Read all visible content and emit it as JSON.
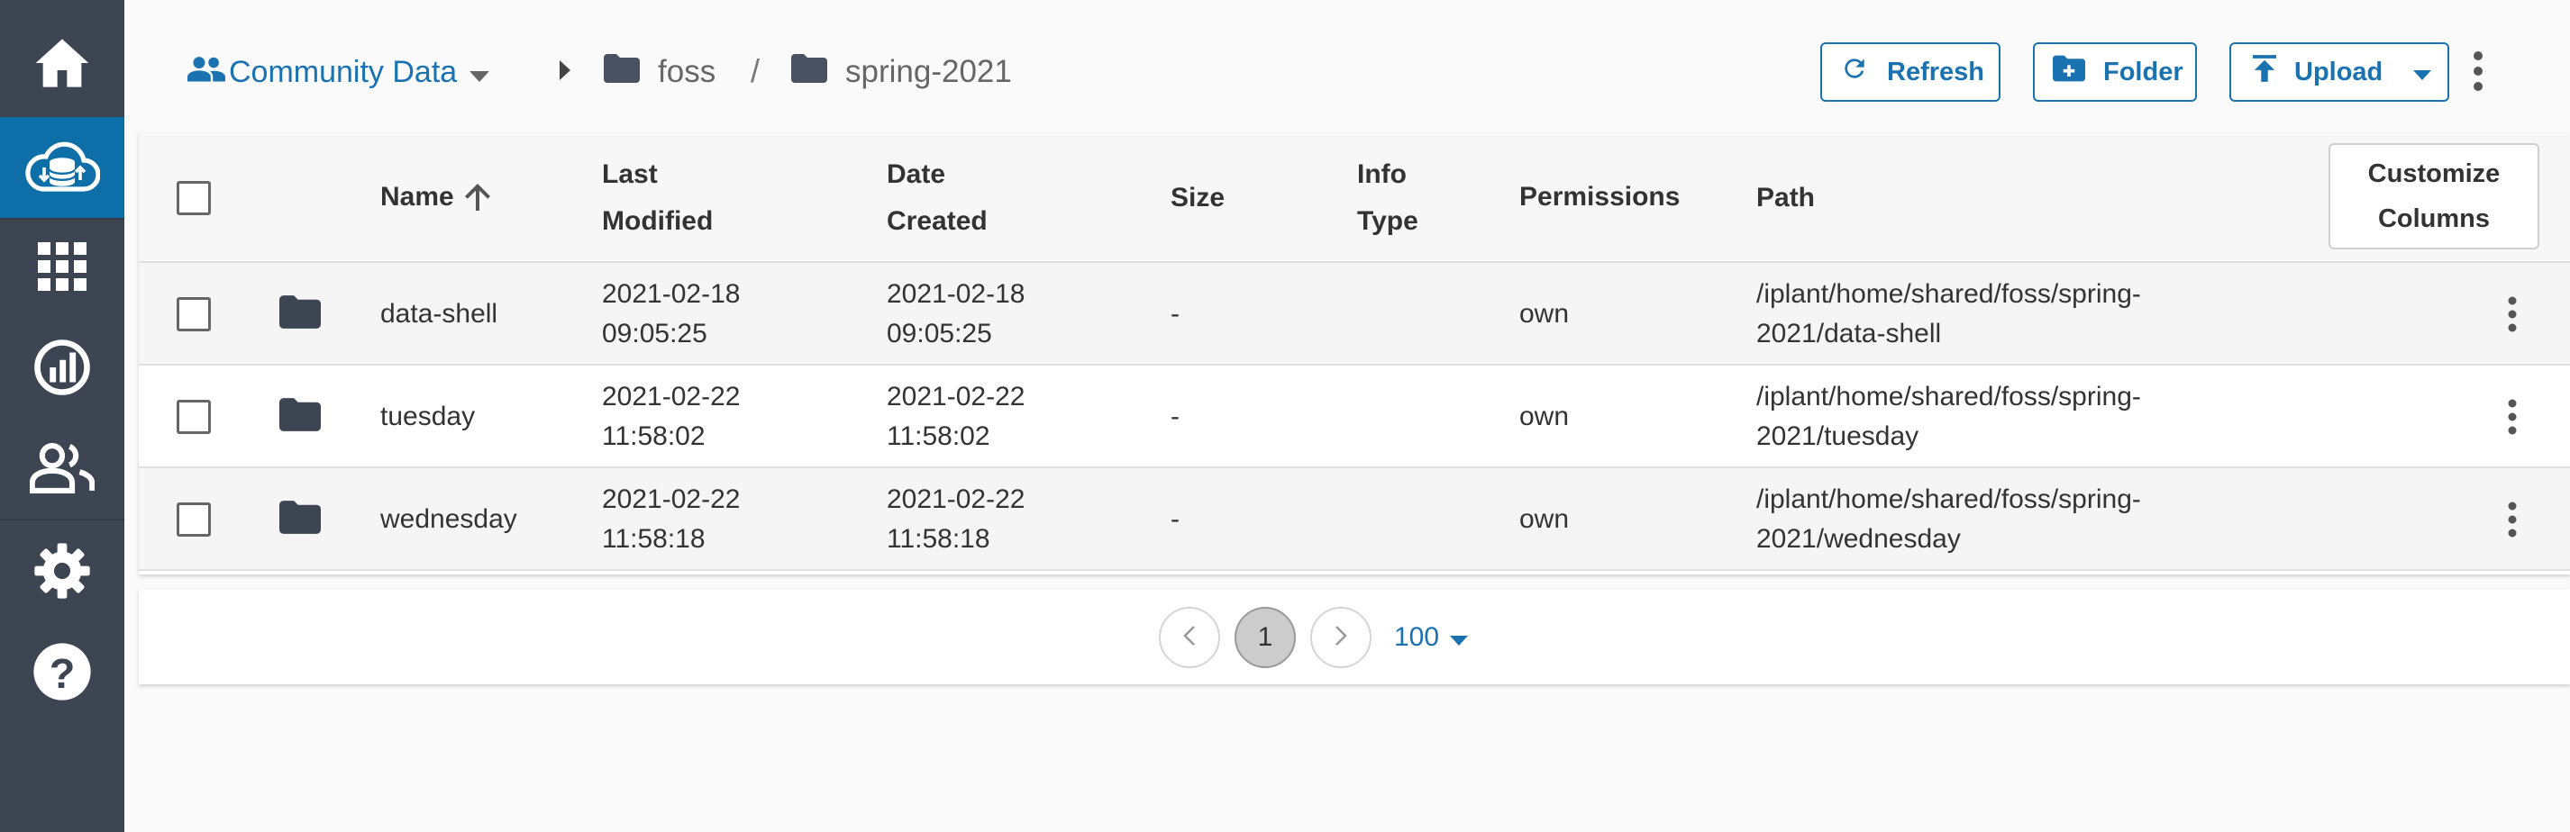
{
  "sidebar": {
    "items": [
      {
        "name": "home",
        "icon": "home-icon"
      },
      {
        "name": "data",
        "icon": "cloud-data-icon",
        "active": true
      },
      {
        "name": "apps",
        "icon": "apps-grid-icon"
      },
      {
        "name": "analyses",
        "icon": "analyses-chart-icon"
      },
      {
        "name": "teams",
        "icon": "people-icon"
      },
      {
        "name": "settings",
        "icon": "gear-icon"
      },
      {
        "name": "help",
        "icon": "help-icon"
      }
    ],
    "colors": {
      "background": "#3e4552",
      "active": "#0e6fa8"
    }
  },
  "breadcrumb": {
    "root": "Community Data",
    "path": [
      "foss",
      "spring-2021"
    ],
    "separator": "/"
  },
  "toolbar": {
    "refresh_label": "Refresh",
    "folder_label": "Folder",
    "upload_label": "Upload"
  },
  "table": {
    "columns": {
      "name": "Name",
      "last_modified_1": "Last",
      "last_modified_2": "Modified",
      "date_created_1": "Date",
      "date_created_2": "Created",
      "size": "Size",
      "info_type_1": "Info",
      "info_type_2": "Type",
      "permissions": "Permissions",
      "path": "Path"
    },
    "sort": {
      "column": "Name",
      "direction": "ascending"
    },
    "customize_1": "Customize",
    "customize_2": "Columns",
    "rows": [
      {
        "name": "data-shell",
        "modified_date": "2021-02-18",
        "modified_time": "09:05:25",
        "created_date": "2021-02-18",
        "created_time": "09:05:25",
        "size": "-",
        "info_type": "",
        "permissions": "own",
        "path_1": "/iplant/home/shared/foss/spring-",
        "path_2": "2021/data-shell"
      },
      {
        "name": "tuesday",
        "modified_date": "2021-02-22",
        "modified_time": "11:58:02",
        "created_date": "2021-02-22",
        "created_time": "11:58:02",
        "size": "-",
        "info_type": "",
        "permissions": "own",
        "path_1": "/iplant/home/shared/foss/spring-",
        "path_2": "2021/tuesday"
      },
      {
        "name": "wednesday",
        "modified_date": "2021-02-22",
        "modified_time": "11:58:18",
        "created_date": "2021-02-22",
        "created_time": "11:58:18",
        "size": "-",
        "info_type": "",
        "permissions": "own",
        "path_1": "/iplant/home/shared/foss/spring-",
        "path_2": "2021/wednesday"
      }
    ]
  },
  "pagination": {
    "current_page": "1",
    "page_size": "100"
  },
  "colors": {
    "accent": "#1b72b0",
    "folder": "#3e4552"
  }
}
